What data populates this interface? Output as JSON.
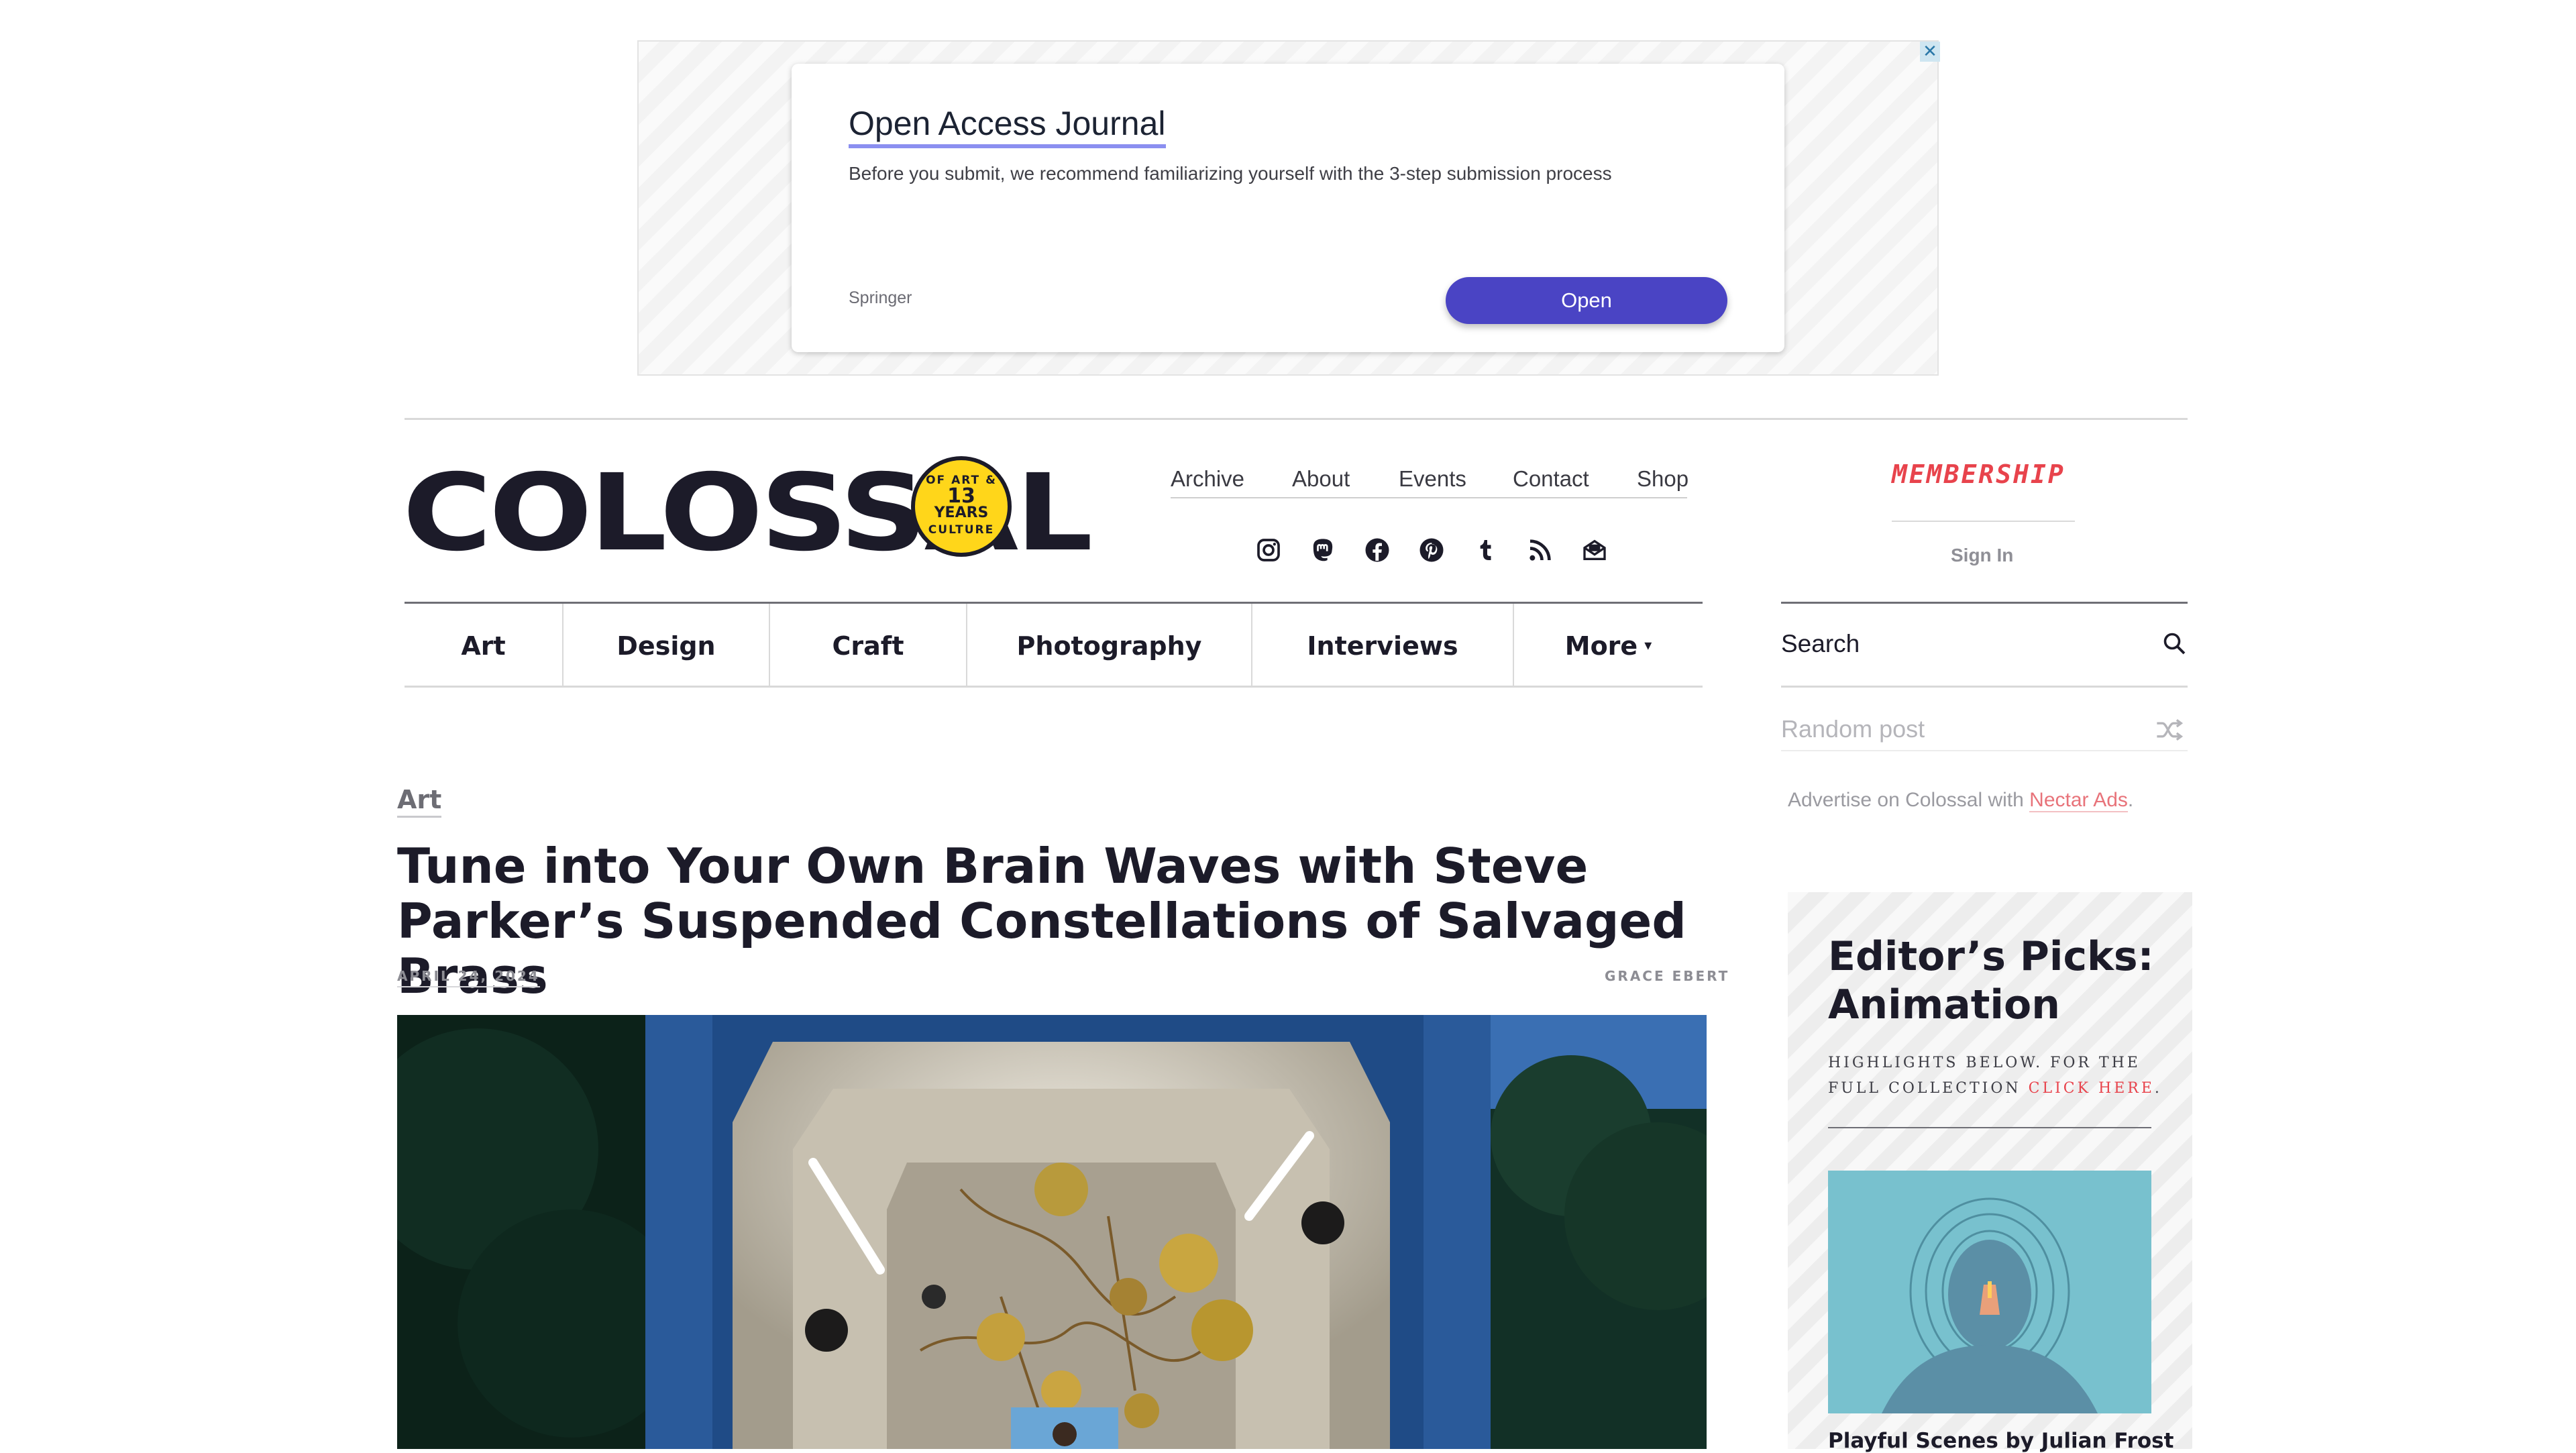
{
  "ad": {
    "title": "Open Access Journal",
    "description": "Before you submit, we recommend familiarizing yourself with the 3-step submission process",
    "source": "Springer",
    "button_label": "Open",
    "close_glyph": "✕"
  },
  "header": {
    "logo_text": "COLOSSAL",
    "badge_small_top": "OF ART &",
    "badge_number": "13",
    "badge_word": "YEARS",
    "badge_small_bottom": "CULTURE",
    "top_nav": [
      "Archive",
      "About",
      "Events",
      "Contact",
      "Shop"
    ],
    "social_icons": [
      "instagram-icon",
      "mastodon-icon",
      "facebook-icon",
      "pinterest-icon",
      "tumblr-icon",
      "rss-icon",
      "newsletter-icon"
    ],
    "membership_label": "MEMBERSHIP",
    "sign_in_label": "Sign In"
  },
  "category_nav": {
    "items": [
      "Art",
      "Design",
      "Craft",
      "Photography",
      "Interviews",
      "More"
    ],
    "more_caret": "▾"
  },
  "sidebar_tools": {
    "search_placeholder": "Search",
    "random_post_label": "Random post",
    "advertise_text": "Advertise on Colossal with ",
    "advertise_link": "Nectar Ads",
    "advertise_period": "."
  },
  "article": {
    "category": "Art",
    "headline": "Tune into Your Own Brain Waves with Steve Parker’s Suspended Constellations of Salvaged Brass",
    "date": "APRIL 24, 2024",
    "author": "GRACE EBERT"
  },
  "editors_picks": {
    "title": "Editor’s Picks: Animation",
    "subtitle": "HIGHLIGHTS BELOW. FOR THE FULL COLLECTION ",
    "subtitle_link": "CLICK HERE",
    "subtitle_end": ".",
    "first_item_title": "Playful Scenes by Julian Frost"
  },
  "colors": {
    "brand_dark": "#1c1b29",
    "accent_red": "#e8434c",
    "ad_button": "#4a44c4",
    "badge_yellow": "#ffd61a"
  }
}
